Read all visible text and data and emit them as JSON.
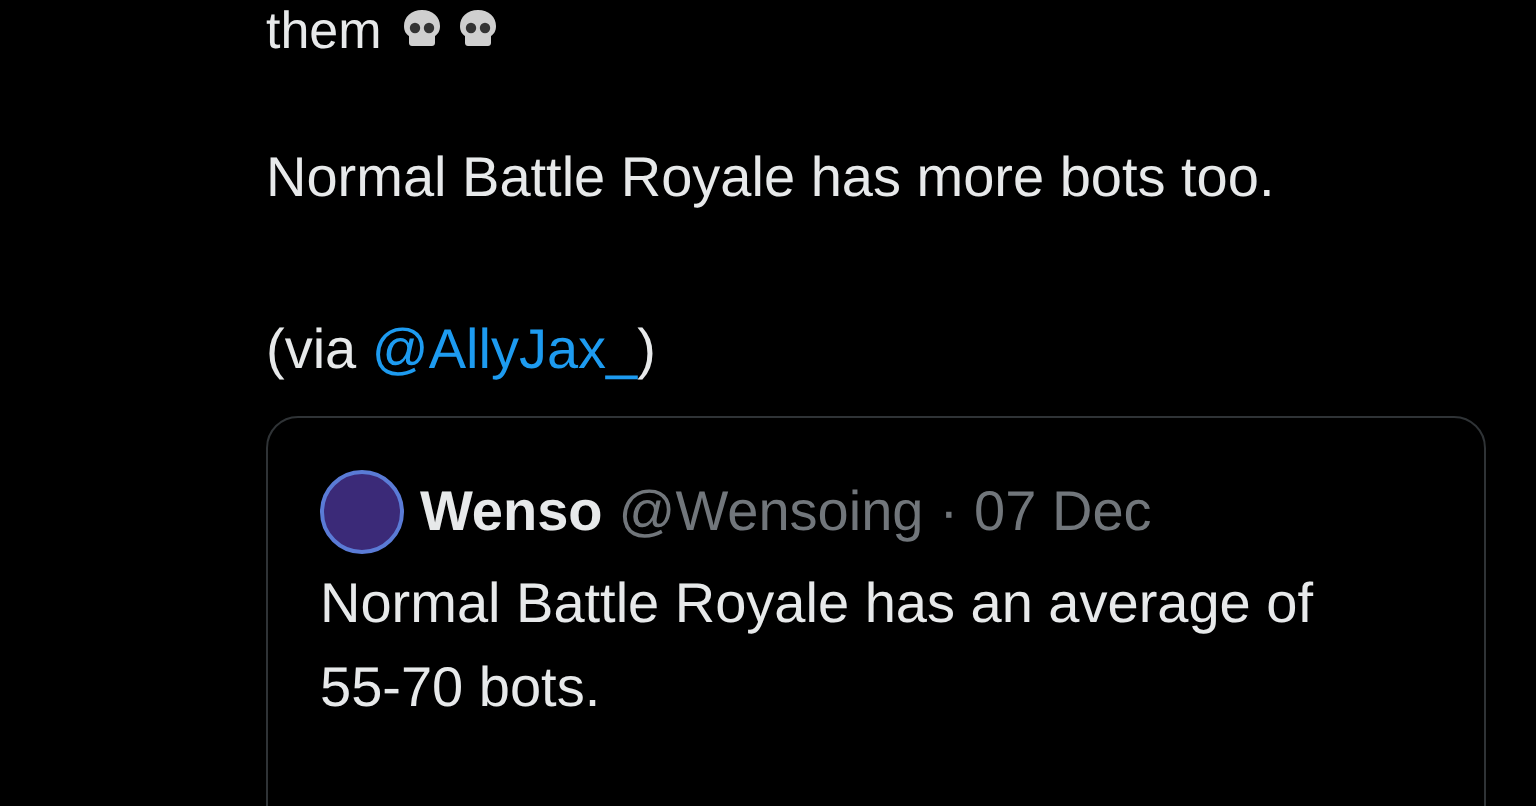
{
  "post": {
    "text_partial": "them",
    "emoji": [
      {
        "kind": "skull"
      },
      {
        "kind": "skull"
      }
    ],
    "paragraph": "Normal Battle Royale has more bots too.",
    "via_prefix": "(via ",
    "via_link": "@AllyJax_",
    "via_suffix": ")"
  },
  "quoted_post": {
    "name": "Wenso",
    "handle": "@Wensoing",
    "separator": "·",
    "date": "07 Dec",
    "text": "Normal Battle Royale has an average of 55-70 bots."
  }
}
